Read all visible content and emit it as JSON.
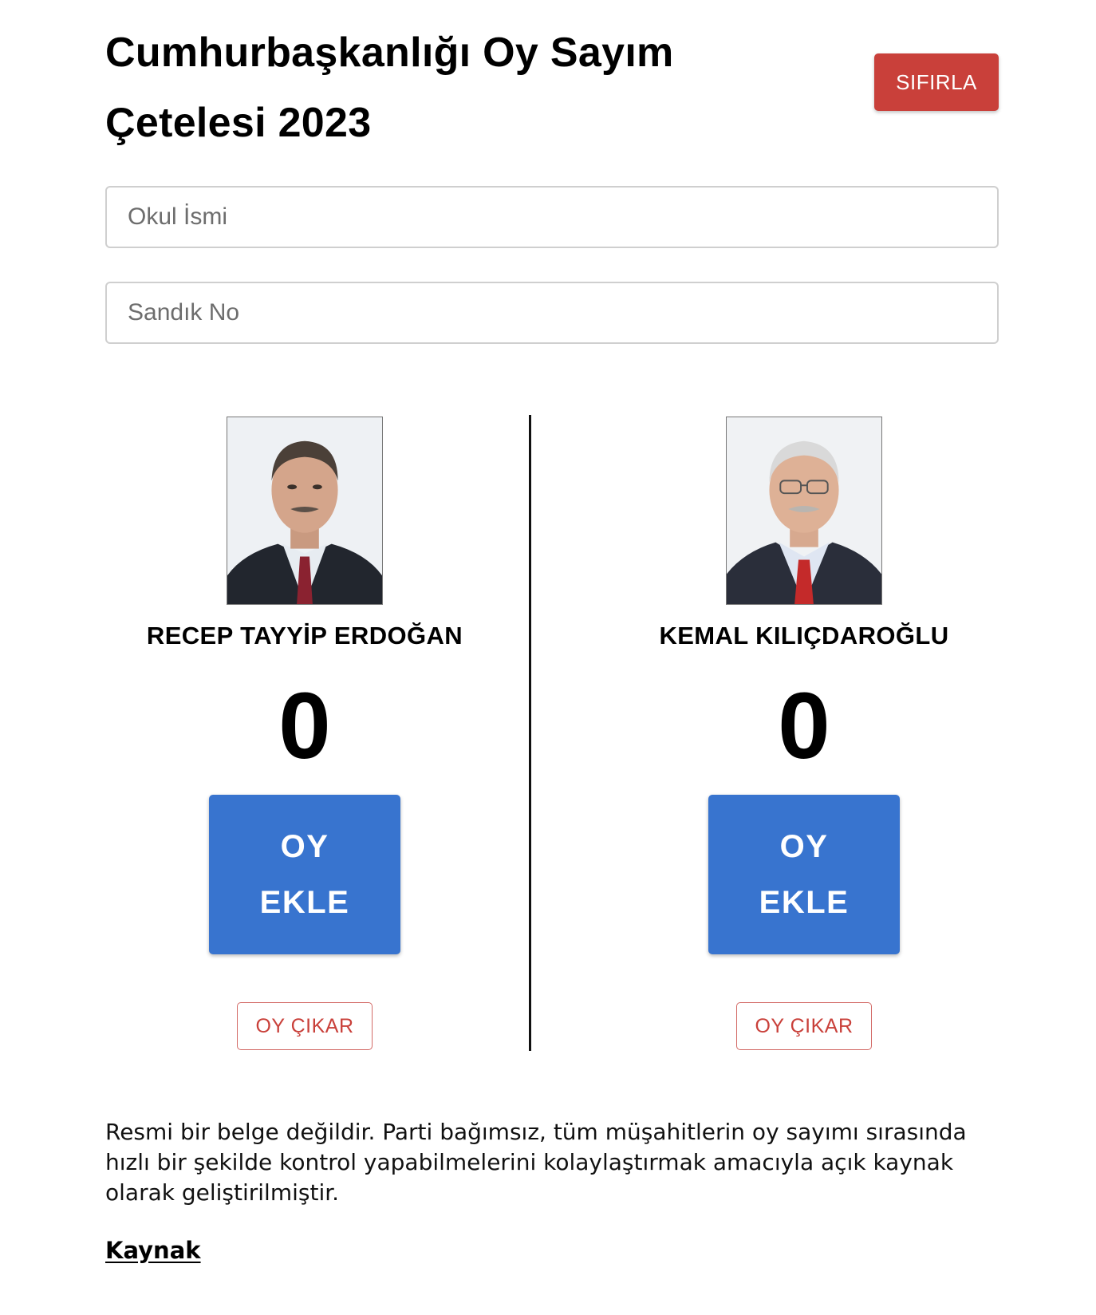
{
  "header": {
    "title": "Cumhurbaşkanlığı Oy Sayım Çetelesi 2023",
    "reset_label": "SIFIRLA"
  },
  "form": {
    "school_placeholder": "Okul İsmi",
    "school_value": "",
    "box_placeholder": "Sandık No",
    "box_value": ""
  },
  "candidates": [
    {
      "name": "RECEP TAYYİP ERDOĞAN",
      "count": "0",
      "add_label": "OY EKLE",
      "remove_label": "OY ÇIKAR"
    },
    {
      "name": "KEMAL KILIÇDAROĞLU",
      "count": "0",
      "add_label": "OY EKLE",
      "remove_label": "OY ÇIKAR"
    }
  ],
  "footer": {
    "disclaimer": "Resmi bir belge değildir. Parti bağımsız, tüm müşahitlerin oy sayımı sırasında hızlı bir şekilde kontrol yapabilmelerini kolaylaştırmak amacıyla açık kaynak olarak geliştirilmiştir.",
    "source_label": "Kaynak"
  },
  "colors": {
    "reset": "#c9403a",
    "add": "#3874cf",
    "remove_border": "#d36a66",
    "divider": "#111111"
  }
}
